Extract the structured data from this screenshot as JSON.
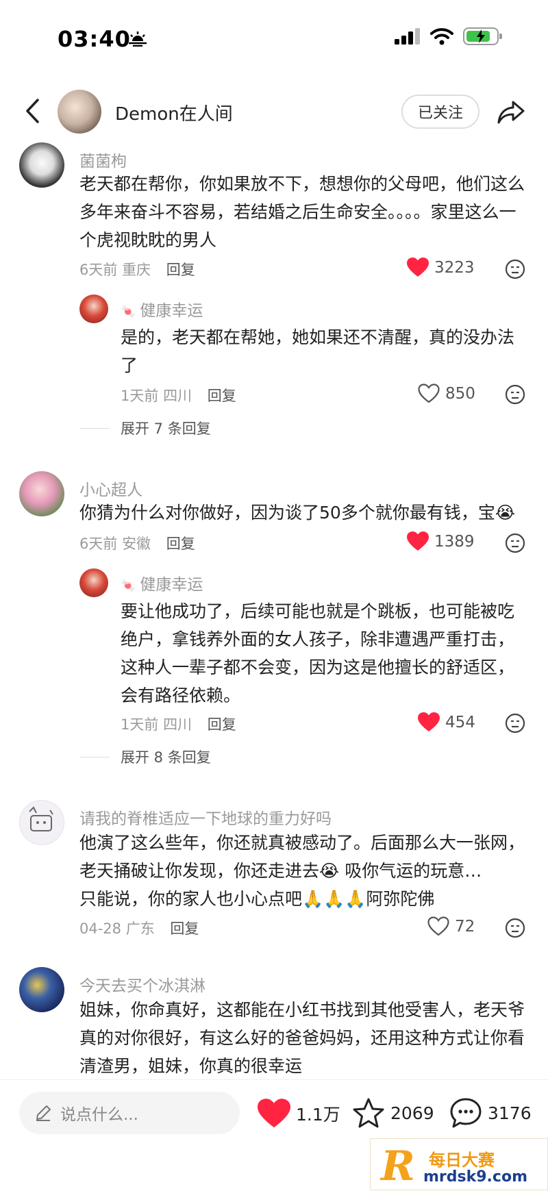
{
  "status_bar": {
    "time": "03:40"
  },
  "header": {
    "user_name": "Demon在人间",
    "follow_label": "已关注"
  },
  "comments": [
    {
      "user": "菌菌枸",
      "text": "老天都在帮你，你如果放不下，想想你的父母吧，他们这么多年来奋斗不容易，若结婚之后生命安全。。。。家里这么一个虎视眈眈的男人",
      "time": "6天前",
      "location": "重庆",
      "reply_label": "回复",
      "likes": "3223",
      "liked": true,
      "replies": [
        {
          "user": "健康幸运",
          "text": "是的，老天都在帮她，她如果还不清醒，真的没办法了",
          "time": "1天前",
          "location": "四川",
          "reply_label": "回复",
          "likes": "850",
          "liked": false
        }
      ],
      "expand_label": "展开 7 条回复"
    },
    {
      "user": "小心超人",
      "text": "你猜为什么对你做好，因为谈了50多个就你最有钱，宝",
      "time": "6天前",
      "location": "安徽",
      "reply_label": "回复",
      "likes": "1389",
      "liked": true,
      "replies": [
        {
          "user": "健康幸运",
          "text": "要让他成功了，后续可能也就是个跳板，也可能被吃绝户，拿钱养外面的女人孩子，除非遭遇严重打击，这种人一辈子都不会变，因为这是他擅长的舒适区，会有路径依赖。",
          "time": "1天前",
          "location": "四川",
          "reply_label": "回复",
          "likes": "454",
          "liked": true
        }
      ],
      "expand_label": "展开 8 条回复"
    },
    {
      "user": "请我的脊椎适应一下地球的重力好吗",
      "text": "他演了这么些年，你还就真被感动了。后面那么大一张网，老天捅破让你发现，你还走进去",
      "text2": "吸你气运的玩意…",
      "text3": "只能说，你的家人也小心点吧",
      "text4": "阿弥陀佛",
      "time": "04-28",
      "location": "广东",
      "reply_label": "回复",
      "likes": "72",
      "liked": false
    },
    {
      "user": "今天去买个冰淇淋",
      "text": "姐妹，你命真好，这都能在小红书找到其他受害人，老天爷真的对你很好，有这么好的爸爸妈妈，还用这种方式让你看清渣男，姐妹，你真的很幸运"
    }
  ],
  "bottom_bar": {
    "input_placeholder": "说点什么...",
    "likes": "1.1万",
    "favorites": "2069",
    "comments": "3176"
  },
  "watermark": {
    "title": "每日大赛",
    "url": "mrdsk9.com"
  },
  "colors": {
    "like_red": "#ff2442",
    "muted_gray": "#9a9a9a"
  }
}
